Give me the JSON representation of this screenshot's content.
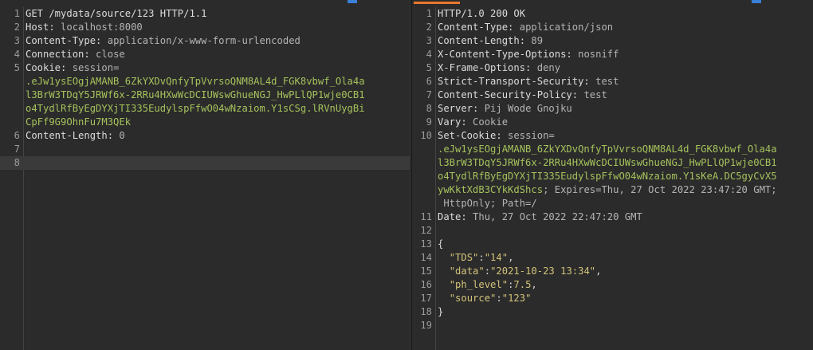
{
  "request": {
    "lines": [
      {
        "n": "1",
        "a": "GET /mydata/source/123 HTTP/1.1",
        "b": ""
      },
      {
        "n": "2",
        "a": "Host:",
        "b": " localhost:8000"
      },
      {
        "n": "3",
        "a": "Content-Type:",
        "b": " application/x-www-form-urlencoded"
      },
      {
        "n": "4",
        "a": "Connection:",
        "b": " close"
      },
      {
        "n": "5",
        "a": "Cookie:",
        "b": " session="
      },
      {
        "n": "",
        "g": ".eJw1ysEOgjAMANB_6ZkYXDvQnfyTpVvrsoQNM8AL4d_FGK8vbwf_Ola4a"
      },
      {
        "n": "",
        "g": "l3BrW3TDqY5JRWf6x-2RRu4HXwWcDCIUWswGhueNGJ_HwPLlQP1wje0CB1"
      },
      {
        "n": "",
        "g": "o4TydlRfByEgDYXjTI335EudylspFfwO04wNzaiom.Y1sCSg.lRVnUygBi"
      },
      {
        "n": "",
        "g": "CpFf9G9OhnFu7M3QEk"
      },
      {
        "n": "6",
        "a": "Content-Length:",
        "b": " 0"
      },
      {
        "n": "7",
        "a": "",
        "b": ""
      },
      {
        "n": "8",
        "a": "",
        "b": "",
        "cursor": true
      }
    ]
  },
  "response": {
    "lines": [
      {
        "n": "1",
        "a": "HTTP/1.0 200 OK",
        "b": ""
      },
      {
        "n": "2",
        "a": "Content-Type:",
        "b": " application/json"
      },
      {
        "n": "3",
        "a": "Content-Length:",
        "b": " 89"
      },
      {
        "n": "4",
        "a": "X-Content-Type-Options:",
        "b": " nosniff"
      },
      {
        "n": "5",
        "a": "X-Frame-Options:",
        "b": " deny"
      },
      {
        "n": "6",
        "a": "Strict-Transport-Security:",
        "b": " test"
      },
      {
        "n": "7",
        "a": "Content-Security-Policy:",
        "b": " test"
      },
      {
        "n": "8",
        "a": "Server:",
        "b": " Pij Wode Gnojku"
      },
      {
        "n": "9",
        "a": "Vary:",
        "b": " Cookie"
      },
      {
        "n": "10",
        "a": "Set-Cookie:",
        "b": " session="
      },
      {
        "n": "",
        "g": ".eJw1ysEOgjAMANB_6ZkYXDvQnfyTpVvrsoQNM8AL4d_FGK8vbwf_Ola4a"
      },
      {
        "n": "",
        "g": "l3BrW3TDqY5JRWf6x-2RRu4HXwWcDCIUWswGhueNGJ_HwPLlQP1wje0CB1"
      },
      {
        "n": "",
        "g": "o4TydlRfByEgDYXjTI335EudylspFfwO04wNzaiom.Y1sKeA.DC5gyCvX5"
      },
      {
        "n": "",
        "g": "ywKktXdB3CYkKdShcs",
        "b": "; Expires=Thu, 27 Oct 2022 23:47:20 GMT;"
      },
      {
        "n": "",
        "a": "",
        "b": " HttpOnly; Path=/"
      },
      {
        "n": "11",
        "a": "Date:",
        "b": " Thu, 27 Oct 2022 22:47:20 GMT"
      },
      {
        "n": "12",
        "a": "",
        "b": ""
      },
      {
        "n": "13",
        "a": "{",
        "b": ""
      },
      {
        "n": "14",
        "a": "  ",
        "k": "\"TDS\"",
        "c": ":",
        "v": "\"14\"",
        "e": ","
      },
      {
        "n": "15",
        "a": "  ",
        "k": "\"data\"",
        "c": ":",
        "v": "\"2021-10-23 13:34\"",
        "e": ","
      },
      {
        "n": "16",
        "a": "  ",
        "k": "\"ph_level\"",
        "c": ":",
        "v": "7.5",
        "e": ","
      },
      {
        "n": "17",
        "a": "  ",
        "k": "\"source\"",
        "c": ":",
        "v": "\"123\"",
        "e": ""
      },
      {
        "n": "18",
        "a": "}",
        "b": ""
      },
      {
        "n": "19",
        "a": "",
        "b": ""
      }
    ]
  }
}
